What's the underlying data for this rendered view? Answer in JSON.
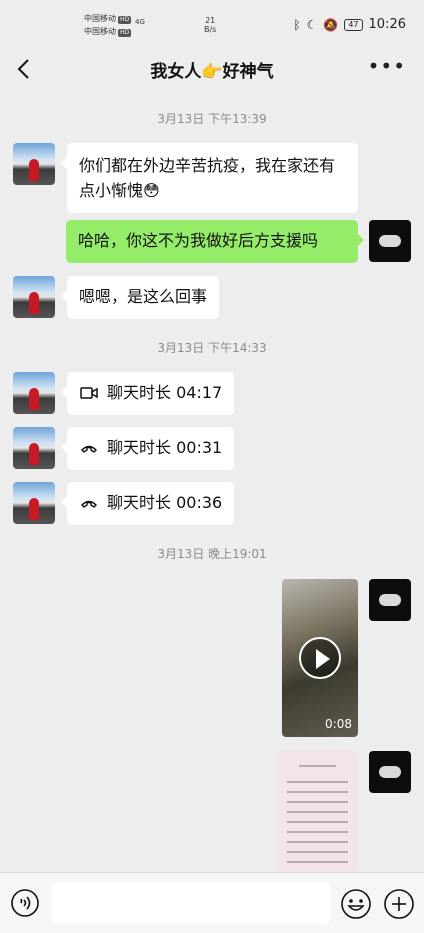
{
  "status_bar": {
    "carrier1": "中国移动",
    "carrier2": "中国移动",
    "hd_badge": "HD",
    "network": "4G",
    "speed_value": "21",
    "speed_unit": "B/s",
    "battery": "47",
    "time": "10:26"
  },
  "chat": {
    "title": "我女人👉好神气"
  },
  "messages": {
    "ts1": "3月13日 下午13:39",
    "m1": "你们都在外边辛苦抗疫，我在家还有点小惭愧😳",
    "m2": "哈哈，你这不为我做好后方支援吗",
    "m3": "嗯嗯，是这么回事",
    "ts2": "3月13日 下午14:33",
    "call1": "聊天时长 04:17",
    "call2": "聊天时长 00:31",
    "call3": "聊天时长 00:36",
    "ts3": "3月13日 晚上19:01",
    "video_duration": "0:08"
  },
  "icons": {
    "back": "back-arrow-icon",
    "more": "more-icon",
    "video_call": "video-call-icon",
    "voice_call": "phone-icon",
    "voice": "voice-input-icon",
    "emoji": "emoji-icon",
    "plus": "plus-icon"
  },
  "colors": {
    "sent_bubble": "#95ec69",
    "received_bubble": "#ffffff",
    "background": "#ededed"
  }
}
